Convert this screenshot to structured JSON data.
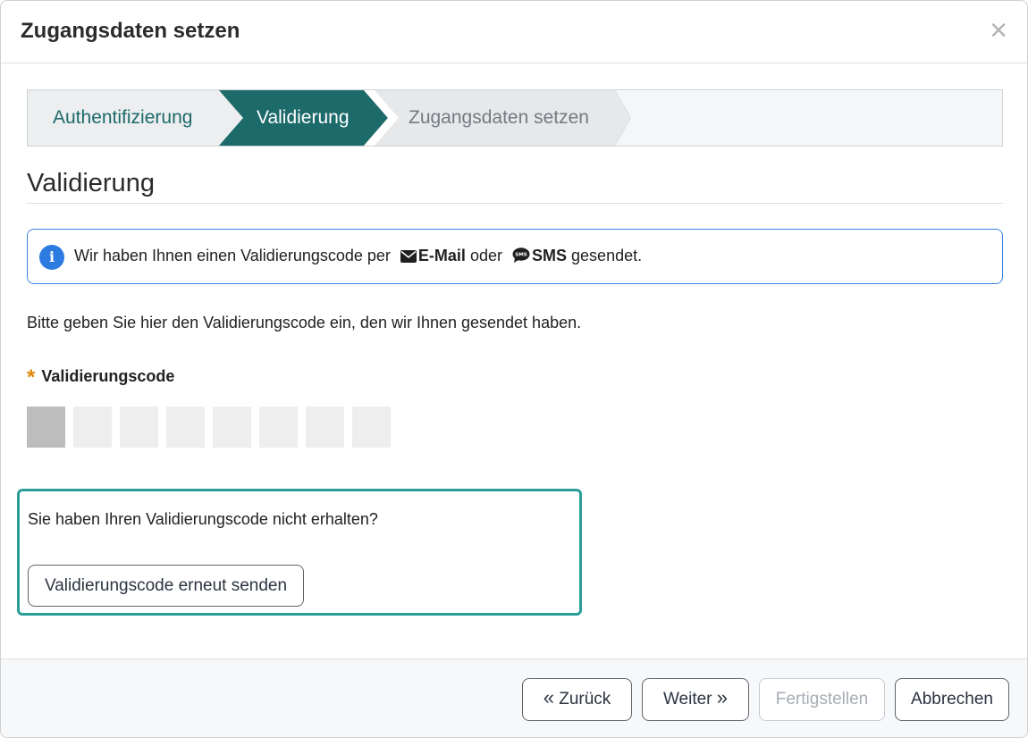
{
  "dialog": {
    "title": "Zugangsdaten setzen",
    "close_glyph": "×"
  },
  "steps": [
    {
      "label": "Authentifizierung",
      "state": "completed"
    },
    {
      "label": "Validierung",
      "state": "active"
    },
    {
      "label": "Zugangsdaten setzen",
      "state": "upcoming"
    }
  ],
  "section": {
    "title": "Validierung"
  },
  "info": {
    "icon": "info-icon",
    "text_before": "Wir haben Ihnen einen Validierungscode per",
    "email_label": "E-Mail",
    "connector": "oder",
    "sms_label": "SMS",
    "text_after": "gesendet."
  },
  "instruction": "Bitte geben Sie hier den Validierungscode ein, den wir Ihnen gesendet haben.",
  "field": {
    "required_marker": "*",
    "label": "Validierungscode",
    "digits": [
      "",
      "",
      "",
      "",
      "",
      "",
      "",
      ""
    ]
  },
  "resend": {
    "question": "Sie haben Ihren Validierungscode nicht erhalten?",
    "button_label": "Validierungscode erneut senden"
  },
  "footer": {
    "back_label": "Zurück",
    "next_label": "Weiter",
    "finish_label": "Fertigstellen",
    "cancel_label": "Abbrechen"
  },
  "colors": {
    "accent_teal": "#1d6a6b",
    "panel_border": "#2a9d98",
    "info_border": "#3b82e0",
    "required": "#e08a0b"
  }
}
